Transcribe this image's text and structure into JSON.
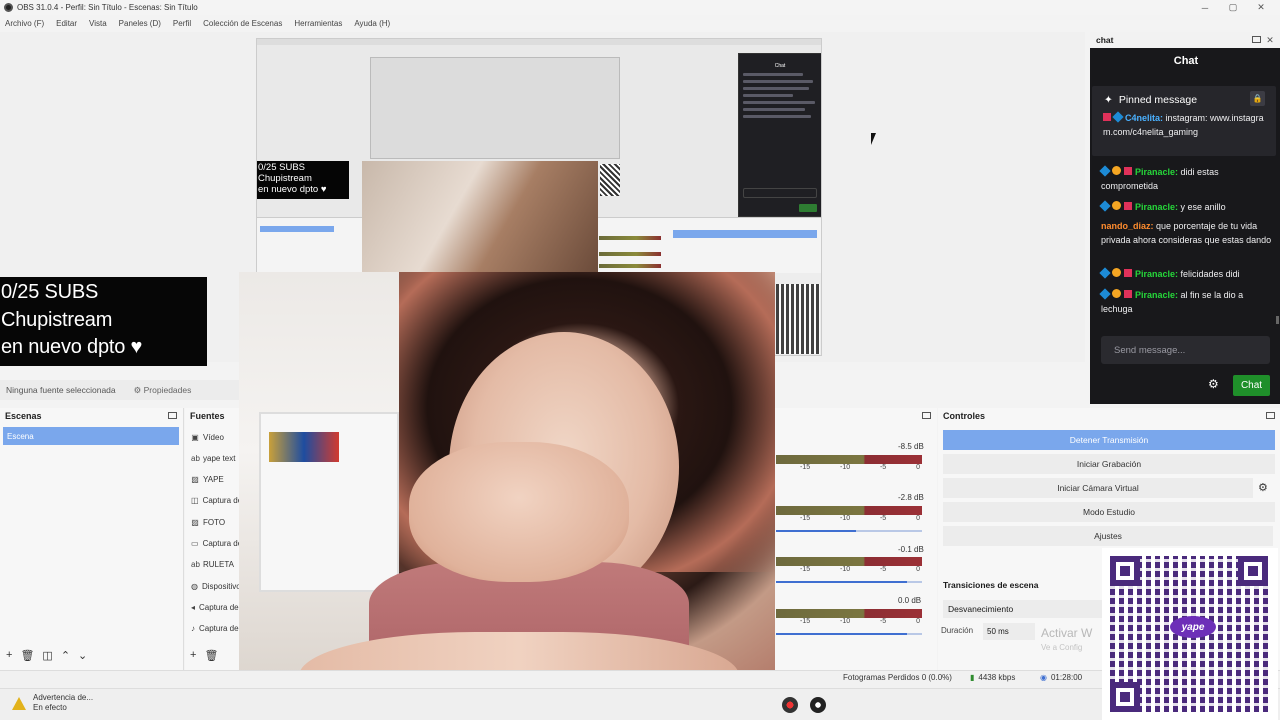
{
  "window": {
    "title": "OBS 31.0.4 - Perfil: Sin Título - Escenas: Sin Título"
  },
  "menu": [
    "Archivo (F)",
    "Editar",
    "Vista",
    "Paneles (D)",
    "Perfil",
    "Colección de Escenas",
    "Herramientas",
    "Ayuda (H)"
  ],
  "overlay": {
    "line1": "0/25 SUBS",
    "line2": "Chupistream",
    "line3": "en nuevo dpto ♥"
  },
  "source_toolbar": {
    "no_source": "Ninguna fuente seleccionada",
    "properties": "Propiedades"
  },
  "scenes": {
    "title": "Escenas",
    "items": [
      "Escena"
    ]
  },
  "sources": {
    "title": "Fuentes",
    "items": [
      {
        "label": "Vídeo",
        "icon": "camera-icon"
      },
      {
        "label": "yape text",
        "icon": "text-icon"
      },
      {
        "label": "YAPE",
        "icon": "image-icon"
      },
      {
        "label": "Captura de ventana",
        "icon": "window-capture-icon"
      },
      {
        "label": "FOTO",
        "icon": "image-icon"
      },
      {
        "label": "Captura de pantalla",
        "icon": "display-capture-icon"
      },
      {
        "label": "RULETA",
        "icon": "text-icon"
      },
      {
        "label": "Dispositivo",
        "icon": "speaker-icon"
      },
      {
        "label": "Captura de audio",
        "icon": "speaker-icon"
      },
      {
        "label": "Captura de audio",
        "icon": "mic-icon"
      }
    ]
  },
  "mixer": {
    "channels": [
      {
        "db": "-8.5 dB",
        "volume": 1.0
      },
      {
        "db": "-2.8 dB",
        "volume": 0.55
      },
      {
        "db": "-0.1 dB",
        "volume": 0.9
      },
      {
        "db": "0.0 dB",
        "volume": 0.9
      }
    ],
    "scale": [
      "-15",
      "-10",
      "-5",
      "0"
    ]
  },
  "controls": {
    "title": "Controles",
    "buttons": [
      "Detener Transmisión",
      "Iniciar Grabación",
      "Iniciar Cámara Virtual",
      "Modo Estudio",
      "Ajustes"
    ],
    "transitions_title": "Transiciones de escena",
    "transition": "Desvanecimiento",
    "duration_label": "Duración",
    "duration_value": "50 ms",
    "activate_text": "Activar W",
    "activate_sub": "Ve a Config"
  },
  "status": {
    "frames_dropped": "Fotogramas Perdidos 0 (0.0%)",
    "bitrate": "4438 kbps",
    "time": "01:28:00"
  },
  "taskbar": {
    "warning_line1": "Advertencia de...",
    "warning_line2": "En efecto"
  },
  "chat": {
    "dock_title": "chat",
    "title": "Chat",
    "pinned_label": "Pinned message",
    "pinned": {
      "user": "C4nelita:",
      "text": "instagram: www.instagram.com/c4nelita_gaming"
    },
    "messages": [
      {
        "user": "Piranacle:",
        "text": "didi estas comprometida",
        "color": "green"
      },
      {
        "user": "Piranacle:",
        "text": "y ese anillo",
        "color": "green"
      },
      {
        "user": "nando_diaz:",
        "text": "que porcentaje de tu vida privada ahora consideras que estas dando",
        "color": "orange"
      },
      {
        "user": "Piranacle:",
        "text": "felicidades didi",
        "color": "green"
      },
      {
        "user": "Piranacle:",
        "text": "al fin se la dio a lechuga",
        "color": "green"
      }
    ],
    "input_placeholder": "Send message...",
    "send_label": "Chat"
  },
  "qr": {
    "logo_text": "yape"
  }
}
